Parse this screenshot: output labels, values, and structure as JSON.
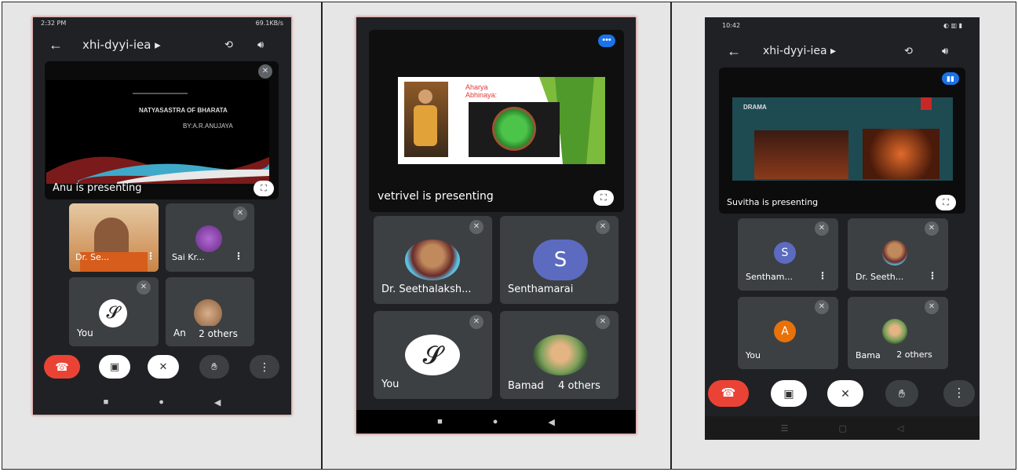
{
  "phone1": {
    "status_time": "2:32 PM",
    "status_right": "69.1KB/s",
    "meeting_code": "xhi-dyyi-iea ▸",
    "slide_title": "NATYASASTRA OF BHARATA",
    "slide_subtitle": "BY:A.R.ANUJAYA",
    "presenting_label": "Anu is presenting",
    "tiles": [
      {
        "name": "Dr. Se..."
      },
      {
        "name": "Sai Kr..."
      },
      {
        "name": "You"
      },
      {
        "name": "An"
      }
    ],
    "others_label": "2 others"
  },
  "phone2": {
    "slide_heading_line1": "Aharya",
    "slide_heading_line2": "Abhinaya:",
    "presenting_label": "vetrivel is presenting",
    "tiles": [
      {
        "name": "Dr. Seethalaksh..."
      },
      {
        "name": "Senthamarai",
        "initial": "S"
      },
      {
        "name": "You"
      },
      {
        "name": "Bamad"
      }
    ],
    "others_label": "4 others"
  },
  "phone3": {
    "status_time": "10:42",
    "meeting_code": "xhi-dyyi-iea ▸",
    "slide_title": "DRAMA",
    "presenting_label": "Suvitha is presenting",
    "tiles": [
      {
        "name": "Sentham...",
        "initial": "S"
      },
      {
        "name": "Dr. Seeth..."
      },
      {
        "name": "You",
        "initial": "A"
      },
      {
        "name": "Bama"
      }
    ],
    "others_label": "2 others"
  },
  "colors": {
    "bg": "#202124",
    "tile": "#3c4043",
    "end_call": "#ea4335",
    "avatar_blue": "#5c6bc0",
    "avatar_orange": "#e8710a"
  },
  "icons": {
    "back": "arrow-left-icon",
    "switch_camera": "switch-camera-icon",
    "speaker": "speaker-icon",
    "mic_off": "mic-off-icon",
    "camera_off": "camera-off-icon",
    "raise_hand": "hand-icon",
    "more": "more-vert-icon",
    "end_call": "end-call-icon",
    "fullscreen": "fullscreen-icon"
  }
}
